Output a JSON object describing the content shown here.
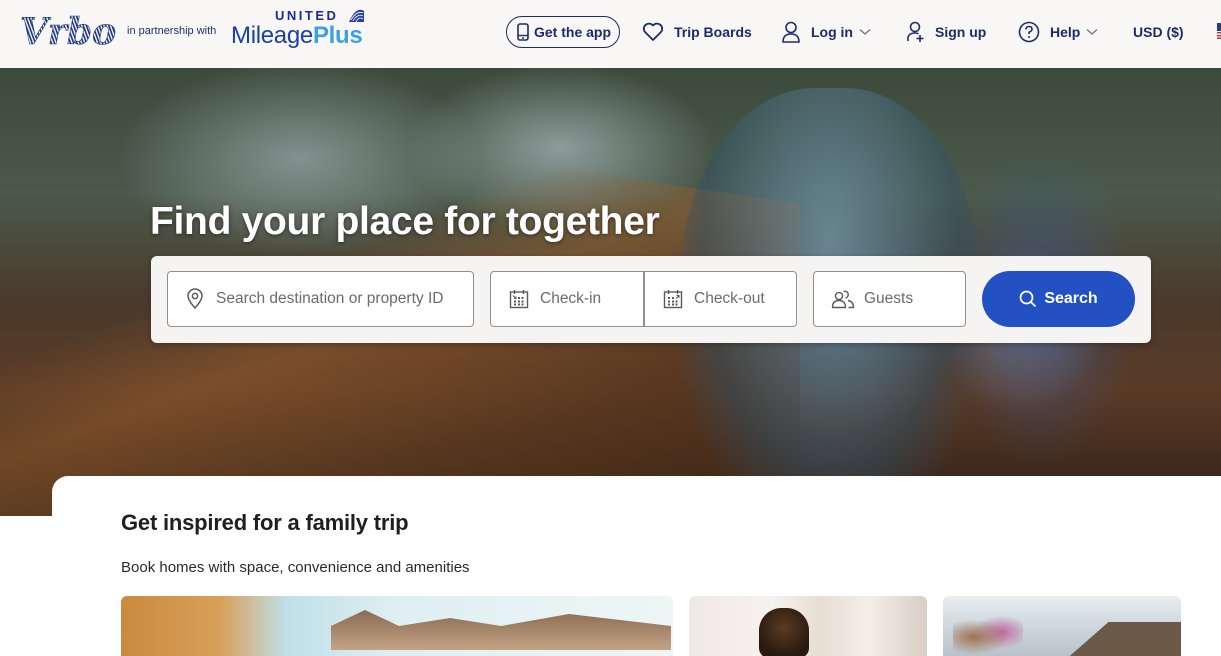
{
  "header": {
    "brand": "Vrbo",
    "partner_text": "in partnership with",
    "partner_brand_top": "UNITED",
    "partner_brand_main": "Mileage",
    "partner_brand_plus": "Plus",
    "nav": {
      "get_app": "Get the app",
      "trip_boards": "Trip Boards",
      "log_in": "Log in",
      "sign_up": "Sign up",
      "help": "Help",
      "currency": "USD ($)"
    },
    "icons": {
      "get_app": "phone-icon",
      "trip_boards": "heart-icon",
      "log_in": "user-icon",
      "sign_up": "user-plus-icon",
      "help": "help-circle-icon",
      "flag": "us-flag-icon"
    }
  },
  "hero": {
    "title": "Find your place for together",
    "search": {
      "destination_placeholder": "Search destination or property ID",
      "checkin_placeholder": "Check-in",
      "checkout_placeholder": "Check-out",
      "guests_placeholder": "Guests",
      "search_label": "Search"
    }
  },
  "section": {
    "title": "Get inspired for a family trip",
    "subtitle": "Book homes with space, convenience and amenities"
  },
  "colors": {
    "brand_navy": "#1c2b6e",
    "search_button": "#2351c4",
    "header_bg": "#f8f7f5",
    "mileageplus_blue": "#1a3fa9",
    "plus_light_blue": "#3da0e0"
  }
}
